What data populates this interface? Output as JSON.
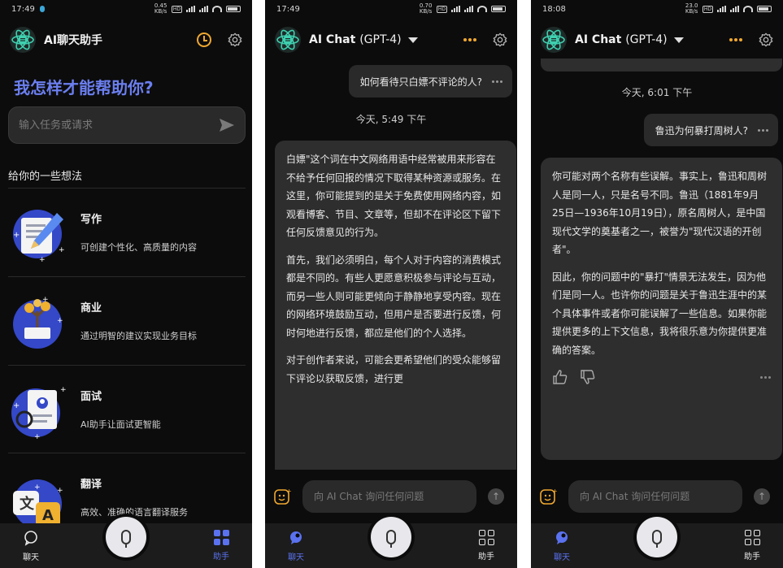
{
  "panel1": {
    "status": {
      "time": "17:49",
      "net": "0.45 KB/s"
    },
    "header": {
      "title": "AI聊天助手"
    },
    "headline": "我怎样才能帮助你?",
    "search": {
      "placeholder": "输入任务或请求"
    },
    "ideas_title": "给你的一些想法",
    "features": [
      {
        "name": "写作",
        "desc": "可创建个性化、高质量的内容",
        "icon": "writing-icon"
      },
      {
        "name": "商业",
        "desc": "通过明智的建议实现业务目标",
        "icon": "business-icon"
      },
      {
        "name": "面试",
        "desc": "AI助手让面试更智能",
        "icon": "interview-icon"
      },
      {
        "name": "翻译",
        "desc": "高效、准确的语言翻译服务",
        "icon": "translate-icon"
      }
    ],
    "nav": {
      "chat": "聊天",
      "assistant": "助手"
    }
  },
  "panel2": {
    "status": {
      "time": "17:49",
      "net": "0.70 KB/s"
    },
    "header": {
      "title": "AI Chat",
      "model": "(GPT-4)"
    },
    "user_message": "如何看待只白嫖不评论的人?",
    "timestamp": "今天, 5:49 下午",
    "ai_paragraphs": [
      "白嫖\"这个词在中文网络用语中经常被用来形容在不给予任何回报的情况下取得某种资源或服务。在这里，你可能提到的是关于免费使用网络内容，如观看博客、节目、文章等，但却不在评论区下留下任何反馈意见的行为。",
      "首先，我们必须明白，每个人对于内容的消费模式都是不同的。有些人更愿意积极参与评论与互动，而另一些人则可能更倾向于静静地享受内容。现在的网络环境鼓励互动，但用户是否要进行反馈，何时何地进行反馈，都应是他们的个人选择。",
      "对于创作者来说，可能会更希望他们的受众能够留下评论以获取反馈，进行更"
    ],
    "input": {
      "placeholder": "向 AI Chat 询问任何问题"
    },
    "nav": {
      "chat": "聊天",
      "assistant": "助手"
    }
  },
  "panel3": {
    "status": {
      "time": "18:08",
      "net": "23.0 KB/s"
    },
    "header": {
      "title": "AI Chat",
      "model": "(GPT-4)"
    },
    "timestamp": "今天, 6:01 下午",
    "user_message": "鲁迅为何暴打周树人?",
    "ai_paragraphs": [
      "你可能对两个名称有些误解。事实上，鲁迅和周树人是同一人，只是名号不同。鲁迅（1881年9月25日—1936年10月19日），原名周树人，是中国现代文学的奠基者之一，被誉为\"现代汉语的开创者\"。",
      "因此，你的问题中的\"暴打\"情景无法发生，因为他们是同一人。也许你的问题是关于鲁迅生涯中的某个具体事件或者你可能误解了一些信息。如果你能提供更多的上下文信息，我将很乐意为你提供更准确的答案。"
    ],
    "input": {
      "placeholder": "向 AI Chat 询问任何问题"
    },
    "nav": {
      "chat": "聊天",
      "assistant": "助手"
    }
  },
  "colors": {
    "accent": "#6b7ff0",
    "nav_active": "#5a72f0",
    "highlight": "#f0a830",
    "bubble": "#2e2e2e",
    "background": "#0c0c0c"
  }
}
